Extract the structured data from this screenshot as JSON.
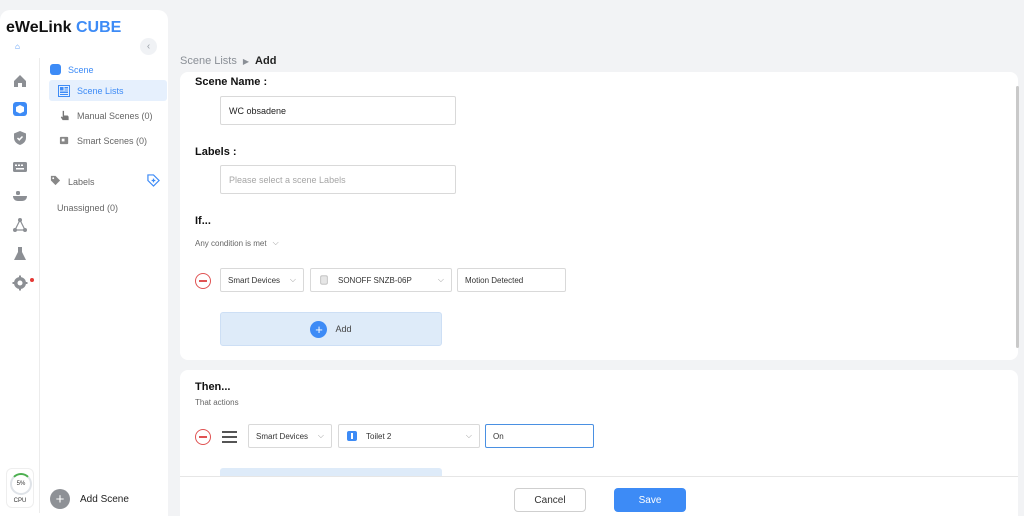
{
  "app": {
    "brand_main": "eWeLink",
    "brand_accent": "CUBE",
    "accent_color": "#3d8bf6"
  },
  "rail": {
    "icons": [
      "home-icon",
      "cube-icon",
      "shield-icon",
      "keyboard-icon",
      "bathtub-icon",
      "network-icon",
      "flask-icon",
      "gear-icon"
    ]
  },
  "cpu": {
    "value": "5%",
    "label": "CPU"
  },
  "nav": {
    "section": "Scene",
    "items": [
      {
        "label": "Scene Lists"
      },
      {
        "label": "Manual Scenes (0)"
      },
      {
        "label": "Smart Scenes (0)"
      }
    ],
    "labels_title": "Labels",
    "unassigned": "Unassigned (0)",
    "add_scene": "Add Scene"
  },
  "breadcrumb": {
    "parent": "Scene Lists",
    "current": "Add"
  },
  "form": {
    "scene_name_title": "Scene Name :",
    "scene_name_value": "WC obsadene",
    "labels_title": "Labels :",
    "labels_placeholder": "Please select a scene Labels",
    "if_title": "If...",
    "if_condition": "Any condition is met",
    "if_row": {
      "type": "Smart Devices",
      "device": "SONOFF SNZB-06P",
      "state": "Motion Detected"
    },
    "add_label": "Add",
    "then_title": "Then...",
    "then_sub": "That actions",
    "then_row": {
      "type": "Smart Devices",
      "device": "Toilet 2",
      "state": "On"
    }
  },
  "footer": {
    "cancel": "Cancel",
    "save": "Save"
  }
}
